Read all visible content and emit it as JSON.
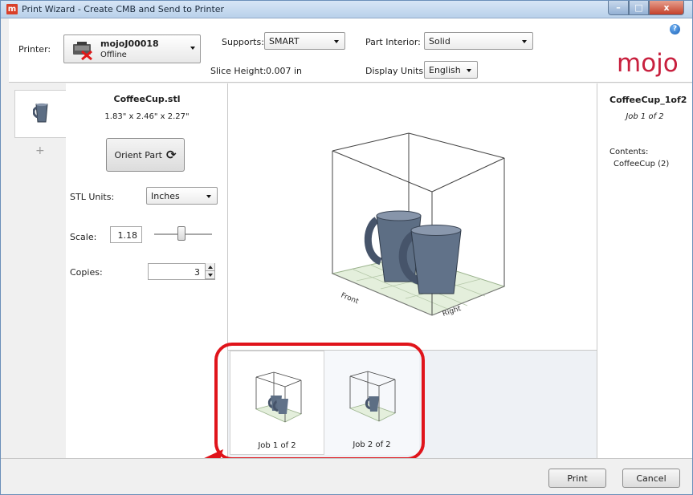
{
  "window": {
    "title": "Print Wizard - Create CMB and Send to Printer",
    "app_icon_letter": "m",
    "minimize_glyph": "–",
    "maximize_glyph": "□",
    "close_glyph": "x"
  },
  "header": {
    "printer_label": "Printer:",
    "printer_name": "mojoJ00018",
    "printer_status": "Offline",
    "supports_label": "Supports:",
    "supports_value": "SMART",
    "part_interior_label": "Part Interior:",
    "part_interior_value": "Solid",
    "slice_height_label": "Slice Height:",
    "slice_height_value": "0.007 in",
    "display_units_label": "Display Units:",
    "display_units_value": "English",
    "help_glyph": "?",
    "logo_text": "mojo"
  },
  "part_tabs": {
    "add_glyph": "+"
  },
  "part": {
    "name": "CoffeeCup.stl",
    "dimensions": "1.83\" x 2.46\" x 2.27\"",
    "orient_button_label": "Orient Part",
    "orient_glyph": "⟳",
    "stl_units_label": "STL Units:",
    "stl_units_value": "Inches",
    "scale_label": "Scale:",
    "scale_value": "1.18",
    "copies_label": "Copies:",
    "copies_value": "3"
  },
  "viewport": {
    "front_label": "Front",
    "right_label": "Right"
  },
  "jobs": [
    {
      "label": "Job 1 of 2"
    },
    {
      "label": "Job 2 of 2"
    }
  ],
  "job_info": {
    "name": "CoffeeCup_1of2",
    "subtitle": "Job 1 of 2",
    "contents_label": "Contents:",
    "contents_item": "CoffeeCup  (2)"
  },
  "footer": {
    "print_label": "Print",
    "cancel_label": "Cancel"
  },
  "colors": {
    "accent_red": "#e0141b",
    "logo_red": "#c8203e",
    "mug_gray": "#5d6e84"
  }
}
